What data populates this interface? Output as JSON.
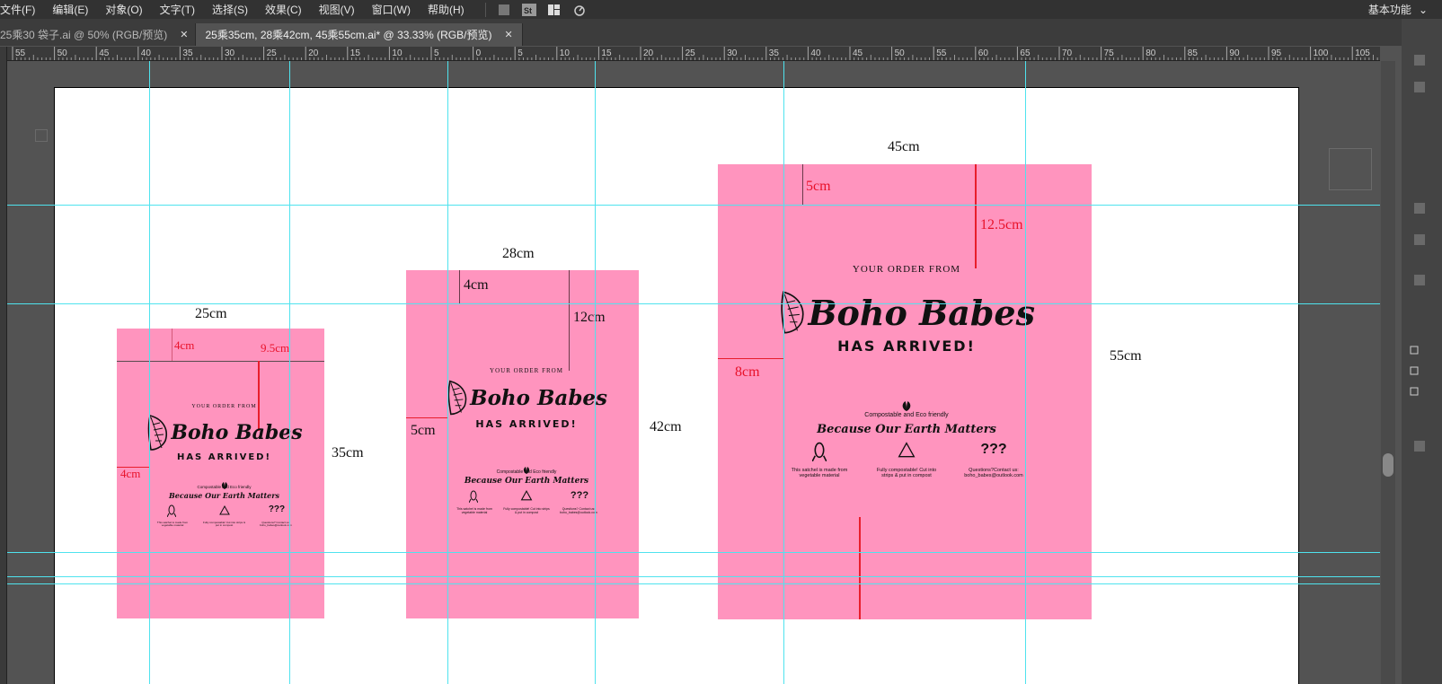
{
  "menu": {
    "items": [
      "文件(F)",
      "编辑(E)",
      "对象(O)",
      "文字(T)",
      "选择(S)",
      "效果(C)",
      "视图(V)",
      "窗口(W)",
      "帮助(H)"
    ],
    "workspace": "基本功能"
  },
  "tabs": [
    {
      "label": "25乘30  袋子.ai @ 50% (RGB/预览)",
      "active": false
    },
    {
      "label": "25乘35cm, 28乘42cm, 45乘55cm.ai* @ 33.33% (RGB/预览)",
      "active": true
    }
  ],
  "ruler": {
    "labels": [
      "55",
      "50",
      "45",
      "40",
      "35",
      "30",
      "25",
      "20",
      "15",
      "10",
      "5",
      "0",
      "5",
      "10",
      "15",
      "20",
      "25",
      "30",
      "35",
      "40",
      "45",
      "50",
      "55",
      "60",
      "65",
      "70",
      "75",
      "80",
      "85",
      "90",
      "95",
      "100",
      "105"
    ]
  },
  "bags": [
    {
      "width_label": "25cm",
      "height_label": "35cm",
      "red_labels": [
        "4cm",
        "9.5cm",
        "4cm"
      ],
      "design": {
        "order": "YOUR ORDER FROM",
        "brand": "Boho Babes",
        "arrived": "HAS ARRIVED!",
        "eco": "Compostable and Eco friendly",
        "because": "Because Our Earth Matters",
        "qqq": "???",
        "cols": [
          "This satchel is made from vegetable material",
          "Fully compostable! Cut into strips & put in compost",
          "Questions? Contact us: boho_babes@outlook.com"
        ]
      }
    },
    {
      "width_label": "28cm",
      "height_label": "42cm",
      "red_labels": [
        "4cm",
        "12cm",
        "5cm"
      ],
      "design": {
        "order": "YOUR ORDER FROM",
        "brand": "Boho Babes",
        "arrived": "HAS ARRIVED!",
        "eco": "Compostable and Eco friendly",
        "because": "Because Our Earth Matters",
        "qqq": "???",
        "cols": [
          "This satchel is made from vegetable material",
          "Fully compostable! Cut into strips & put in compost",
          "Questions? Contact us: boho_babes@outlook.com"
        ]
      }
    },
    {
      "width_label": "45cm",
      "height_label": "55cm",
      "red_labels": [
        "5cm",
        "12.5cm",
        "8cm"
      ],
      "design": {
        "order": "YOUR ORDER FROM",
        "brand": "Boho Babes",
        "arrived": "HAS ARRIVED!",
        "eco": "Compostable and Eco friendly",
        "because": "Because Our Earth Matters",
        "qqq": "???",
        "cols": [
          "This satchel is made from vegetable material",
          "Fully compostable! Cut into strips & put in compost",
          "Questions?Contact us: boho_babes@outlook.com"
        ]
      }
    }
  ],
  "colors": {
    "bag": "#ff94be",
    "guide": "#4fe3ee",
    "red": "#e8122a"
  },
  "icons": [
    "feather-icon",
    "leaf-icon",
    "corn-icon",
    "recycle-icon"
  ]
}
